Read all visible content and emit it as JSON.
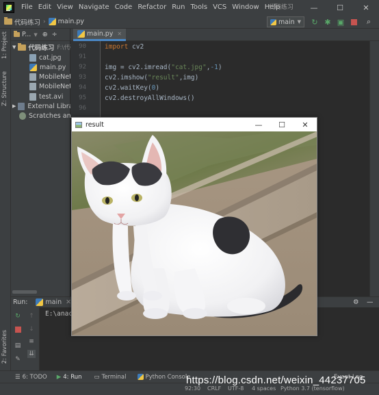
{
  "menubar": {
    "items": [
      "File",
      "Edit",
      "View",
      "Navigate",
      "Code",
      "Refactor",
      "Run",
      "Tools",
      "VCS",
      "Window",
      "Help"
    ],
    "window_title": "代码练习"
  },
  "toolbar": {
    "project_name": "代码练习",
    "file_name": "main.py",
    "branch": "main"
  },
  "left_strip": {
    "project_tab": "1: Project",
    "structure_tab": "Z: Structure",
    "favorites_tab": "2: Favorites"
  },
  "project_panel": {
    "header": "P...",
    "root": "代码练习",
    "root_path": "F:\\代码",
    "files": [
      "cat.jpg",
      "main.py",
      "MobileNet",
      "MobileNet",
      "test.avi"
    ],
    "external": "External Librar",
    "scratches": "Scratches and"
  },
  "editor": {
    "tab_label": "main.py",
    "line_numbers": [
      "90",
      "91",
      "92",
      "93",
      "94",
      "95",
      "96"
    ],
    "code": {
      "l90_kw": "import",
      "l90_rest": " cv2",
      "l92_pre": "img = cv2.imread(",
      "l92_str": "\"cat.jpg\"",
      "l92_sep": ",",
      "l92_num": "-1",
      "l92_end": ")",
      "l93_pre": "cv2.imshow(",
      "l93_str": "\"result\"",
      "l93_end": ",img)",
      "l94_pre": "cv2.waitKey(",
      "l94_num": "0",
      "l94_end": ")",
      "l95": "cv2.destroyAllWindows()"
    }
  },
  "run_panel": {
    "label": "Run:",
    "config": "main",
    "console_text": "E:\\anac"
  },
  "bottom_tabs": {
    "todo": "6: TODO",
    "run": "4: Run",
    "terminal": "Terminal",
    "python_console": "Python Console"
  },
  "status_bar": {
    "position": "92:30",
    "line_sep": "CRLF",
    "encoding": "UTF-8",
    "indent": "4 spaces",
    "interpreter": "Python 3.7 (tensorflow)",
    "event_log": "Event Log"
  },
  "watermark": "https://blog.csdn.net/weixin_44237705",
  "result_window": {
    "title": "result",
    "image_subject": "white-kitten-photo"
  },
  "colors": {
    "ide_bg": "#2b2b2b",
    "panel_bg": "#3c3f41",
    "keyword": "#cc7832",
    "string": "#6a8759",
    "number": "#6897bb",
    "accent": "#4a88c7"
  }
}
